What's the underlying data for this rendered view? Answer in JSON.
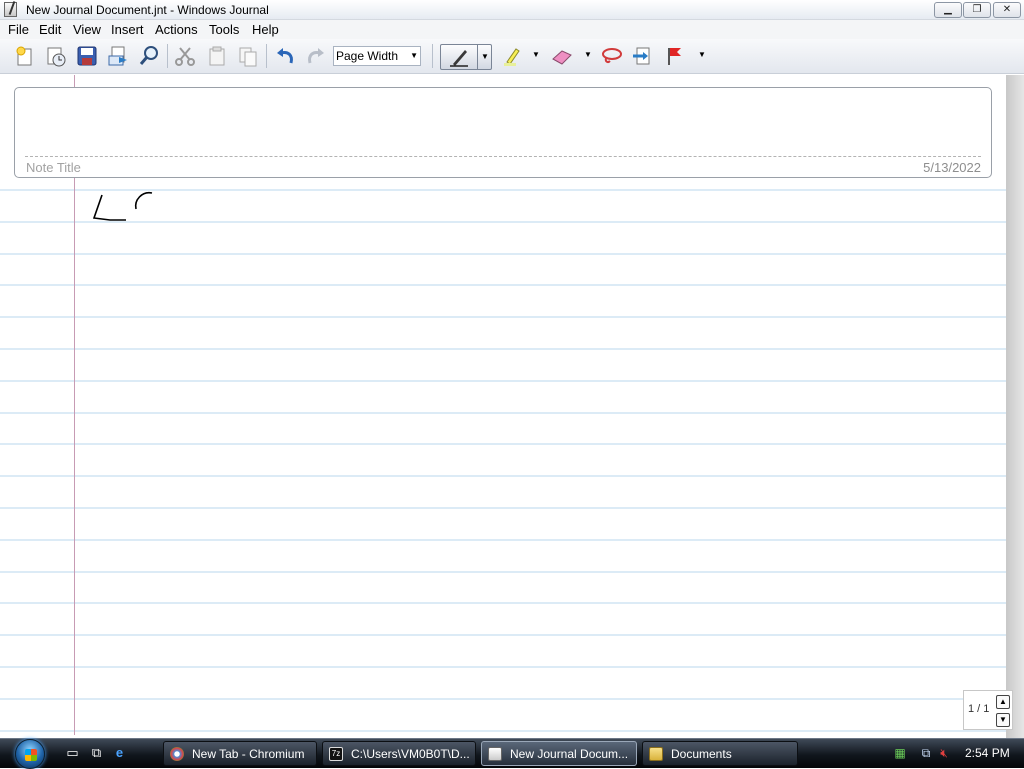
{
  "window": {
    "title": "New Journal Document.jnt - Windows Journal",
    "buttons": {
      "minimize": "▁",
      "maximize": "❐",
      "close": "✕"
    }
  },
  "menu": [
    "File",
    "Edit",
    "View",
    "Insert",
    "Actions",
    "Tools",
    "Help"
  ],
  "toolbar": {
    "zoom_value": "Page Width",
    "icons": [
      "new-note-icon",
      "new-from-template-icon",
      "save-icon",
      "send-to-mail-icon",
      "find-icon",
      "cut-icon",
      "copy-icon",
      "paste-icon",
      "undo-icon",
      "redo-icon",
      "pen-icon",
      "highlighter-icon",
      "eraser-icon",
      "lasso-icon",
      "insert-space-icon",
      "flag-icon"
    ]
  },
  "note": {
    "title_placeholder": "Note Title",
    "date": "5/13/2022"
  },
  "page_nav": {
    "label": "1 / 1"
  },
  "taskbar": {
    "tasks": [
      {
        "label": "New Tab - Chromium",
        "icon": "chromium-icon",
        "active": false
      },
      {
        "label": "C:\\Users\\VM0B0T\\D...",
        "icon": "7zip-icon",
        "active": false
      },
      {
        "label": "New Journal Docum...",
        "icon": "journal-icon",
        "active": true
      },
      {
        "label": "Documents",
        "icon": "folder-icon",
        "active": false
      }
    ],
    "quick_launch": [
      "show-desktop-icon",
      "switch-windows-icon",
      "internet-explorer-icon"
    ],
    "clock": "2:54 PM"
  },
  "colors": {
    "rule_line": "#b9d7ec",
    "margin_line": "#c79bb4",
    "taskbar": "#11161d"
  }
}
